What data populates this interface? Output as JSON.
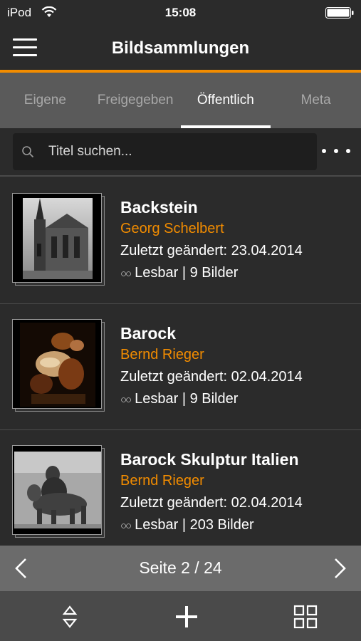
{
  "status": {
    "carrier": "iPod",
    "time": "15:08"
  },
  "nav": {
    "title": "Bildsammlungen"
  },
  "tabs": [
    {
      "label": "Eigene",
      "active": false
    },
    {
      "label": "Freigegeben",
      "active": false
    },
    {
      "label": "Öffentlich",
      "active": true
    },
    {
      "label": "Meta",
      "active": false
    }
  ],
  "search": {
    "placeholder": "Titel suchen..."
  },
  "collections": [
    {
      "title": "Backstein",
      "author": "Georg Schelbert",
      "modified": "Zuletzt geändert: 23.04.2014",
      "access": "Lesbar | 9 Bilder"
    },
    {
      "title": "Barock",
      "author": "Bernd Rieger",
      "modified": "Zuletzt geändert: 02.04.2014",
      "access": "Lesbar | 9 Bilder"
    },
    {
      "title": "Barock Skulptur Italien",
      "author": "Bernd Rieger",
      "modified": "Zuletzt geändert: 02.04.2014",
      "access": "Lesbar | 203 Bilder"
    }
  ],
  "pager": {
    "label": "Seite 2 / 24"
  },
  "colors": {
    "accent": "#f28c00",
    "background": "#2b2b2b",
    "tabbar": "#5a5a5a",
    "pager": "#6b6b6b",
    "toolbar": "#4a4a4a"
  },
  "icons": {
    "menu": "hamburger-icon",
    "search": "search-icon",
    "more": "more-dots-icon",
    "prev": "chevron-left-icon",
    "next": "chevron-right-icon",
    "sort": "sort-icon",
    "add": "plus-icon",
    "grid": "grid-icon",
    "access": "glasses-icon"
  }
}
